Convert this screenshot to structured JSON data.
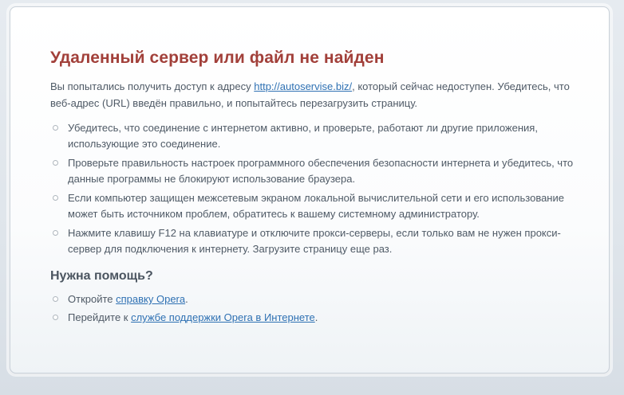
{
  "error": {
    "title": "Удаленный сервер или файл не найден",
    "intro_before": "Вы попытались получить доступ к адресу ",
    "url": "http://autoservise.biz/",
    "intro_after": ", который сейчас недоступен. Убедитесь, что веб-адрес (URL) введён правильно, и попытайтесь перезагрузить страницу.",
    "tips": [
      "Убедитесь, что соединение с интернетом активно, и проверьте, работают ли другие приложения, использующие это соединение.",
      "Проверьте правильность настроек программного обеспечения безопасности интернета и убедитесь, что данные программы не блокируют использование браузера.",
      "Если компьютер защищен межсетевым экраном локальной вычислительной сети и его использование может быть источником проблем, обратитесь к вашему системному администратору.",
      "Нажмите клавишу F12 на клавиатуре и отключите прокси-серверы, если только вам не нужен прокси-сервер для подключения к интернету. Загрузите страницу еще раз."
    ]
  },
  "help": {
    "title": "Нужна помощь?",
    "item1_before": "Откройте ",
    "item1_link": "справку Opera",
    "item1_after": ".",
    "item2_before": "Перейдите к ",
    "item2_link": "службе поддержки Opera в Интернете",
    "item2_after": "."
  }
}
